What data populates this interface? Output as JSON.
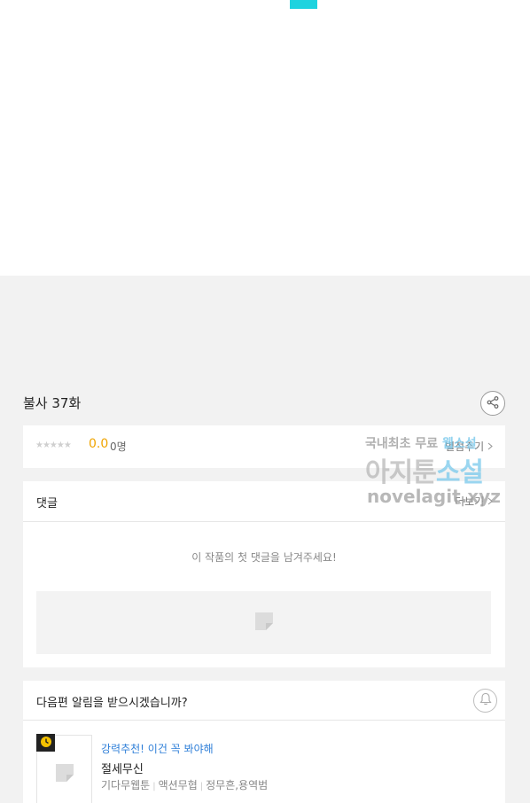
{
  "episode": {
    "title": "불사 37화"
  },
  "rating": {
    "stars": "★★★★★",
    "score": "0.0",
    "count": "0명",
    "rate_link": "별점주기"
  },
  "comments": {
    "title": "댓글",
    "more": "더보기",
    "empty_message": "이 작품의 첫 댓글을 남겨주세요!"
  },
  "notify": {
    "question": "다음편 알림을 받으시겠습니까?",
    "recommend_label": "강력추천! 이건 꼭 봐야해",
    "recommend_title": "절세무신",
    "genre1": "기다무웹툰",
    "genre2": "액션무협",
    "authors": "정무흔,용역범"
  },
  "watermark": {
    "line1_a": "국내최초 무료 ",
    "line1_b": "웹소설",
    "line2_a": "아지툰",
    "line2_b": "소설",
    "line3": "novelagit.xyz"
  },
  "colors": {
    "accent_cyan": "#1ed3df",
    "score": "#f0a400",
    "link_blue": "#2f7fd8"
  },
  "icons": [
    "share-icon",
    "chevron-right-icon",
    "image-placeholder-icon",
    "bell-icon",
    "clock-icon"
  ]
}
